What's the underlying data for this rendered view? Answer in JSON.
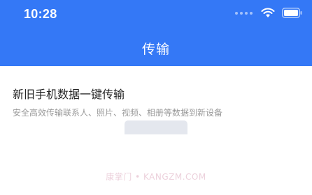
{
  "status_bar": {
    "time": "10:28",
    "icons": [
      "signal-dots-icon",
      "wifi-icon",
      "battery-icon"
    ]
  },
  "nav": {
    "title": "传输"
  },
  "content": {
    "title": "新旧手机数据一键传输",
    "subtitle": "安全高效传输联系人、照片、视频、相册等数据到新设备"
  },
  "watermark": {
    "text": "康掌门 • KANGZM.COM"
  },
  "colors": {
    "header_bg": "#3478f6",
    "page_bg": "#ffffff",
    "title_text": "#222222",
    "subtitle_text": "#9a9a9a"
  }
}
